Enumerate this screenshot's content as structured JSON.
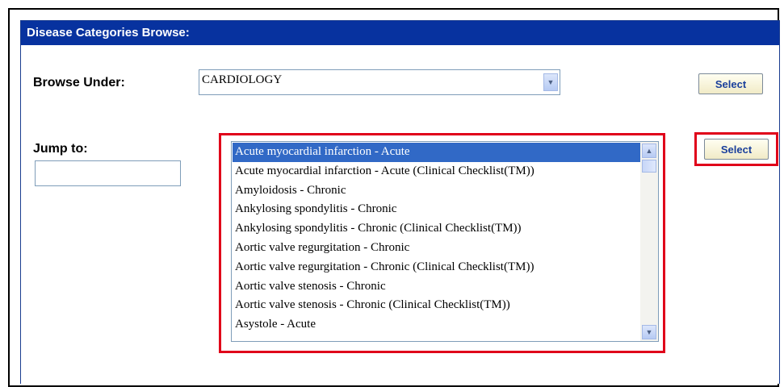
{
  "header": {
    "title": "Disease Categories Browse:"
  },
  "browse": {
    "label": "Browse Under:",
    "selected_value": "CARDIOLOGY",
    "select_label": "Select"
  },
  "jump": {
    "label": "Jump to:",
    "input_value": "",
    "select_label": "Select"
  },
  "list": {
    "items": [
      {
        "label": "Acute myocardial infarction - Acute",
        "selected": true
      },
      {
        "label": "Acute myocardial infarction - Acute (Clinical Checklist(TM))",
        "selected": false
      },
      {
        "label": "Amyloidosis - Chronic",
        "selected": false
      },
      {
        "label": "Ankylosing spondylitis - Chronic",
        "selected": false
      },
      {
        "label": "Ankylosing spondylitis - Chronic (Clinical Checklist(TM))",
        "selected": false
      },
      {
        "label": "Aortic valve regurgitation - Chronic",
        "selected": false
      },
      {
        "label": "Aortic valve regurgitation - Chronic (Clinical Checklist(TM))",
        "selected": false
      },
      {
        "label": "Aortic valve stenosis - Chronic",
        "selected": false
      },
      {
        "label": "Aortic valve stenosis - Chronic (Clinical Checklist(TM))",
        "selected": false
      },
      {
        "label": "Asystole - Acute",
        "selected": false
      }
    ]
  },
  "icons": {
    "dropdown": "chevron-down-icon",
    "scroll_up": "chevron-up-icon",
    "scroll_down": "chevron-down-icon"
  },
  "colors": {
    "header_bg": "#07329f",
    "selection_bg": "#3169c6",
    "highlight": "#e0001a",
    "button_text": "#1a3f9b"
  }
}
